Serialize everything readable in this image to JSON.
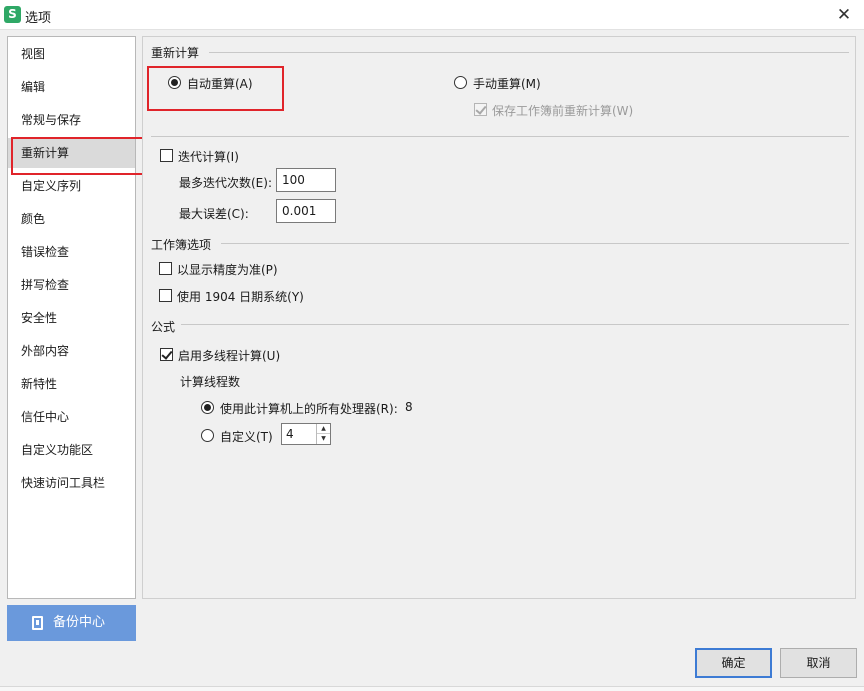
{
  "window": {
    "title": "选项",
    "app_icon_letter": "S"
  },
  "sidebar": {
    "items": [
      {
        "label": "视图"
      },
      {
        "label": "编辑"
      },
      {
        "label": "常规与保存"
      },
      {
        "label": "重新计算"
      },
      {
        "label": "自定义序列"
      },
      {
        "label": "颜色"
      },
      {
        "label": "错误检查"
      },
      {
        "label": "拼写检查"
      },
      {
        "label": "安全性"
      },
      {
        "label": "外部内容"
      },
      {
        "label": "新特性"
      },
      {
        "label": "信任中心"
      },
      {
        "label": "自定义功能区"
      },
      {
        "label": "快速访问工具栏"
      }
    ],
    "active_index": 3,
    "backup_label": "备份中心"
  },
  "recalc": {
    "section_title": "重新计算",
    "auto_label": "自动重算(A)",
    "manual_label": "手动重算(M)",
    "save_recalc_label": "保存工作簿前重新计算(W)",
    "auto_selected": true
  },
  "iteration": {
    "label": "迭代计算(I)",
    "checked": false,
    "max_iter_label": "最多迭代次数(E):",
    "max_iter_value": "100",
    "max_change_label": "最大误差(C):",
    "max_change_value": "0.001"
  },
  "workbook": {
    "section_title": "工作簿选项",
    "precision_label": "以显示精度为准(P)",
    "date1904_label": "使用 1904 日期系统(Y)"
  },
  "formula": {
    "section_title": "公式",
    "multithread_label": "启用多线程计算(U)",
    "multithread_checked": true,
    "threads_title": "计算线程数",
    "use_all_label": "使用此计算机上的所有处理器(R):",
    "processor_count": "8",
    "custom_label": "自定义(T)",
    "custom_value": "4"
  },
  "footer": {
    "ok_label": "确定",
    "cancel_label": "取消"
  },
  "colors": {
    "accent": "#e0242a",
    "backup_bg": "#6a99dc",
    "default_border": "#3d7bd4"
  },
  "icons": {
    "close": "close-icon",
    "spin_up": "chevron-up-icon",
    "spin_down": "chevron-down-icon"
  }
}
